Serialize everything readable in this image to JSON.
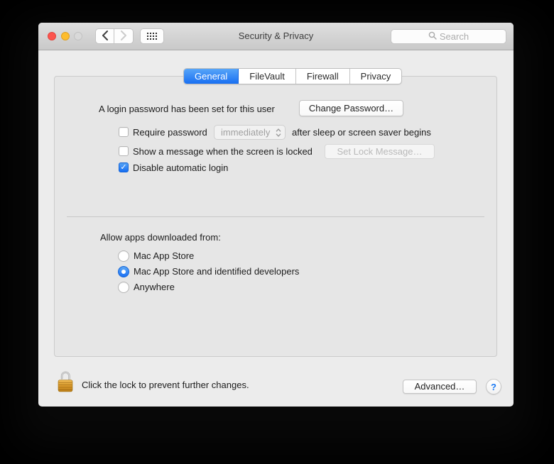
{
  "window": {
    "title": "Security & Privacy",
    "search_placeholder": "Search"
  },
  "tabs": [
    {
      "label": "General",
      "active": true
    },
    {
      "label": "FileVault",
      "active": false
    },
    {
      "label": "Firewall",
      "active": false
    },
    {
      "label": "Privacy",
      "active": false
    }
  ],
  "general": {
    "password_status": "A login password has been set for this user",
    "change_password_label": "Change Password…",
    "require_password": {
      "checked": false,
      "label": "Require password",
      "popup_value": "immediately",
      "popup_enabled": false,
      "suffix": "after sleep or screen saver begins"
    },
    "lock_message": {
      "checked": false,
      "label": "Show a message when the screen is locked",
      "button_label": "Set Lock Message…",
      "button_enabled": false
    },
    "auto_login": {
      "checked": true,
      "label": "Disable automatic login"
    },
    "gatekeeper": {
      "heading": "Allow apps downloaded from:",
      "options": [
        {
          "label": "Mac App Store",
          "selected": false
        },
        {
          "label": "Mac App Store and identified developers",
          "selected": true
        },
        {
          "label": "Anywhere",
          "selected": false
        }
      ]
    }
  },
  "footer": {
    "lock_state": "unlocked",
    "lock_hint": "Click the lock to prevent further changes.",
    "advanced_label": "Advanced…",
    "help_label": "?"
  },
  "icons": {
    "checkmark": "✓"
  },
  "colors": {
    "accent_blue": "#1d70f2",
    "tab_active_gradient_top": "#57a5f8",
    "titlebar_top": "#dfdfdf",
    "titlebar_bottom": "#c9c9c9",
    "traffic_close": "#fc544e",
    "traffic_minimize": "#fdbd2e",
    "traffic_zoom_disabled": "#d9d9d9",
    "lock_gold": "#d89a2b"
  }
}
